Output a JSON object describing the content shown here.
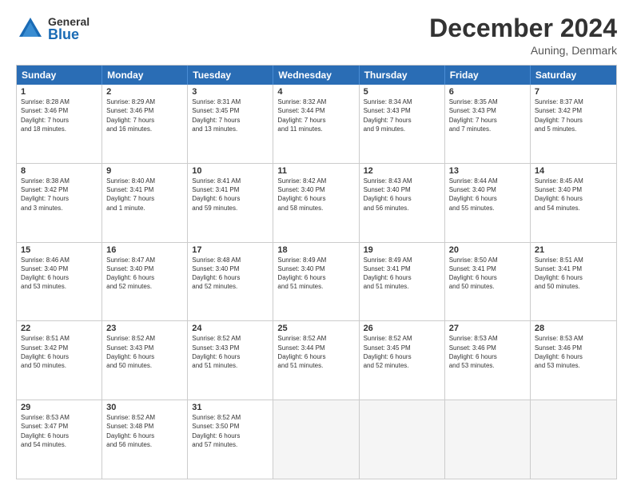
{
  "header": {
    "logo_general": "General",
    "logo_blue": "Blue",
    "month_title": "December 2024",
    "location": "Auning, Denmark"
  },
  "days_of_week": [
    "Sunday",
    "Monday",
    "Tuesday",
    "Wednesday",
    "Thursday",
    "Friday",
    "Saturday"
  ],
  "weeks": [
    [
      {
        "day": "1",
        "info": "Sunrise: 8:28 AM\nSunset: 3:46 PM\nDaylight: 7 hours\nand 18 minutes."
      },
      {
        "day": "2",
        "info": "Sunrise: 8:29 AM\nSunset: 3:46 PM\nDaylight: 7 hours\nand 16 minutes."
      },
      {
        "day": "3",
        "info": "Sunrise: 8:31 AM\nSunset: 3:45 PM\nDaylight: 7 hours\nand 13 minutes."
      },
      {
        "day": "4",
        "info": "Sunrise: 8:32 AM\nSunset: 3:44 PM\nDaylight: 7 hours\nand 11 minutes."
      },
      {
        "day": "5",
        "info": "Sunrise: 8:34 AM\nSunset: 3:43 PM\nDaylight: 7 hours\nand 9 minutes."
      },
      {
        "day": "6",
        "info": "Sunrise: 8:35 AM\nSunset: 3:43 PM\nDaylight: 7 hours\nand 7 minutes."
      },
      {
        "day": "7",
        "info": "Sunrise: 8:37 AM\nSunset: 3:42 PM\nDaylight: 7 hours\nand 5 minutes."
      }
    ],
    [
      {
        "day": "8",
        "info": "Sunrise: 8:38 AM\nSunset: 3:42 PM\nDaylight: 7 hours\nand 3 minutes."
      },
      {
        "day": "9",
        "info": "Sunrise: 8:40 AM\nSunset: 3:41 PM\nDaylight: 7 hours\nand 1 minute."
      },
      {
        "day": "10",
        "info": "Sunrise: 8:41 AM\nSunset: 3:41 PM\nDaylight: 6 hours\nand 59 minutes."
      },
      {
        "day": "11",
        "info": "Sunrise: 8:42 AM\nSunset: 3:40 PM\nDaylight: 6 hours\nand 58 minutes."
      },
      {
        "day": "12",
        "info": "Sunrise: 8:43 AM\nSunset: 3:40 PM\nDaylight: 6 hours\nand 56 minutes."
      },
      {
        "day": "13",
        "info": "Sunrise: 8:44 AM\nSunset: 3:40 PM\nDaylight: 6 hours\nand 55 minutes."
      },
      {
        "day": "14",
        "info": "Sunrise: 8:45 AM\nSunset: 3:40 PM\nDaylight: 6 hours\nand 54 minutes."
      }
    ],
    [
      {
        "day": "15",
        "info": "Sunrise: 8:46 AM\nSunset: 3:40 PM\nDaylight: 6 hours\nand 53 minutes."
      },
      {
        "day": "16",
        "info": "Sunrise: 8:47 AM\nSunset: 3:40 PM\nDaylight: 6 hours\nand 52 minutes."
      },
      {
        "day": "17",
        "info": "Sunrise: 8:48 AM\nSunset: 3:40 PM\nDaylight: 6 hours\nand 52 minutes."
      },
      {
        "day": "18",
        "info": "Sunrise: 8:49 AM\nSunset: 3:40 PM\nDaylight: 6 hours\nand 51 minutes."
      },
      {
        "day": "19",
        "info": "Sunrise: 8:49 AM\nSunset: 3:41 PM\nDaylight: 6 hours\nand 51 minutes."
      },
      {
        "day": "20",
        "info": "Sunrise: 8:50 AM\nSunset: 3:41 PM\nDaylight: 6 hours\nand 50 minutes."
      },
      {
        "day": "21",
        "info": "Sunrise: 8:51 AM\nSunset: 3:41 PM\nDaylight: 6 hours\nand 50 minutes."
      }
    ],
    [
      {
        "day": "22",
        "info": "Sunrise: 8:51 AM\nSunset: 3:42 PM\nDaylight: 6 hours\nand 50 minutes."
      },
      {
        "day": "23",
        "info": "Sunrise: 8:52 AM\nSunset: 3:43 PM\nDaylight: 6 hours\nand 50 minutes."
      },
      {
        "day": "24",
        "info": "Sunrise: 8:52 AM\nSunset: 3:43 PM\nDaylight: 6 hours\nand 51 minutes."
      },
      {
        "day": "25",
        "info": "Sunrise: 8:52 AM\nSunset: 3:44 PM\nDaylight: 6 hours\nand 51 minutes."
      },
      {
        "day": "26",
        "info": "Sunrise: 8:52 AM\nSunset: 3:45 PM\nDaylight: 6 hours\nand 52 minutes."
      },
      {
        "day": "27",
        "info": "Sunrise: 8:53 AM\nSunset: 3:46 PM\nDaylight: 6 hours\nand 53 minutes."
      },
      {
        "day": "28",
        "info": "Sunrise: 8:53 AM\nSunset: 3:46 PM\nDaylight: 6 hours\nand 53 minutes."
      }
    ],
    [
      {
        "day": "29",
        "info": "Sunrise: 8:53 AM\nSunset: 3:47 PM\nDaylight: 6 hours\nand 54 minutes."
      },
      {
        "day": "30",
        "info": "Sunrise: 8:52 AM\nSunset: 3:48 PM\nDaylight: 6 hours\nand 56 minutes."
      },
      {
        "day": "31",
        "info": "Sunrise: 8:52 AM\nSunset: 3:50 PM\nDaylight: 6 hours\nand 57 minutes."
      },
      {
        "day": "",
        "info": ""
      },
      {
        "day": "",
        "info": ""
      },
      {
        "day": "",
        "info": ""
      },
      {
        "day": "",
        "info": ""
      }
    ]
  ]
}
